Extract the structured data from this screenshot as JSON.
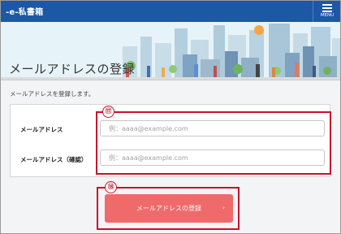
{
  "header": {
    "logo_text": "-e-私書箱",
    "menu_label": "MENU",
    "menu_icon": "hamburger-icon"
  },
  "banner": {
    "title": "メールアドレスの登録"
  },
  "page": {
    "description": "メールアドレスを登録します。"
  },
  "form": {
    "email": {
      "label": "メールアドレス",
      "placeholder": "例：aaaa@example.com",
      "value": ""
    },
    "email_confirm": {
      "label": "メールアドレス（確認）",
      "placeholder": "例：aaaa@example.com",
      "value": ""
    }
  },
  "annotations": {
    "badge_fields": "⑰",
    "badge_submit": "⑱"
  },
  "submit": {
    "label": "メールアドレスの登録",
    "chevron": "›"
  },
  "colors": {
    "header_bg": "#1d57a6",
    "button_bg": "#ef6a6a",
    "annotation_red": "#c8102e",
    "page_bg": "#f3f4f6"
  }
}
